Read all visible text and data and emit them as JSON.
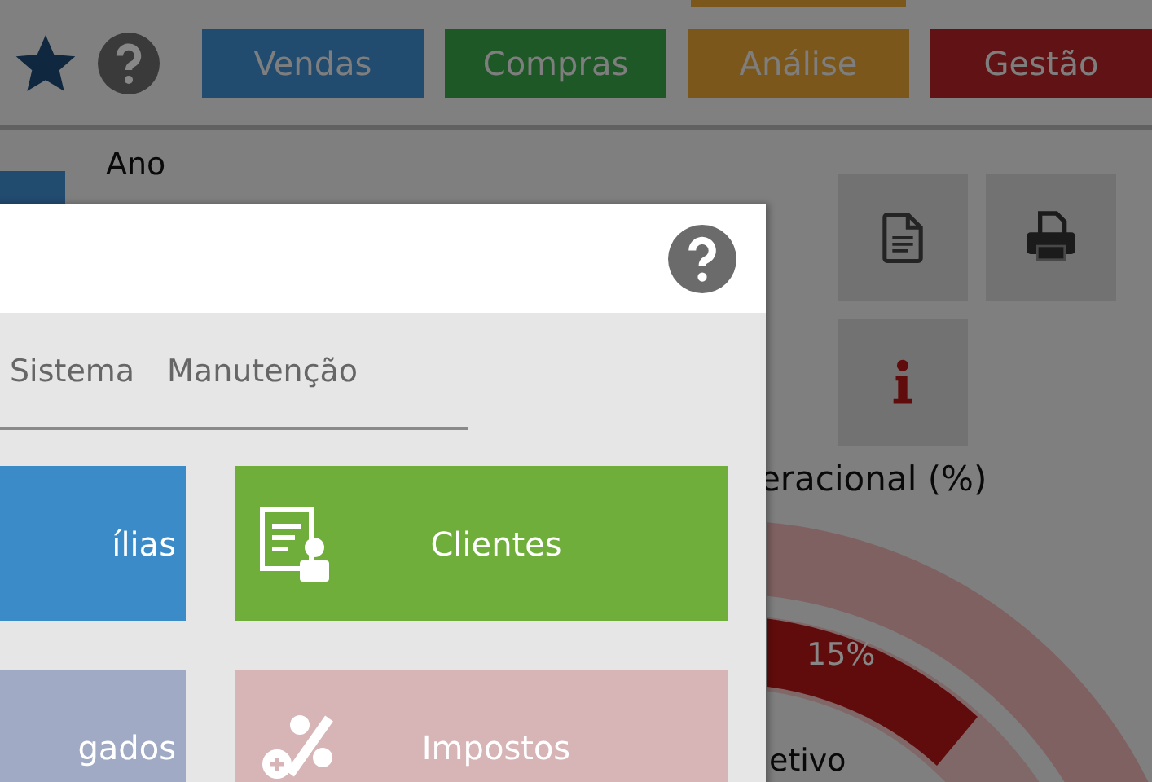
{
  "top_bar": {
    "modules": [
      {
        "label": "Vendas",
        "selected": false
      },
      {
        "label": "Compras",
        "selected": false
      },
      {
        "label": "Análise",
        "selected": true
      },
      {
        "label": "Gestão",
        "selected": false
      }
    ]
  },
  "filter": {
    "label": "Ano"
  },
  "chart_panel": {
    "title": "eracional (%)",
    "gauge_label": "15%",
    "legend": "etivo"
  },
  "dialog": {
    "tabs": [
      {
        "label": "Sistema"
      },
      {
        "label": "Manutenção"
      }
    ],
    "tiles": [
      {
        "label": "ílias",
        "color": "#3a8bc8",
        "kind": "plain"
      },
      {
        "label": "Clientes",
        "color": "#6fae3b",
        "kind": "client"
      },
      {
        "label": "gados",
        "color": "#a0aac4",
        "kind": "plain"
      },
      {
        "label": "Impostos",
        "color": "#d7b4b6",
        "kind": "tax"
      }
    ]
  }
}
